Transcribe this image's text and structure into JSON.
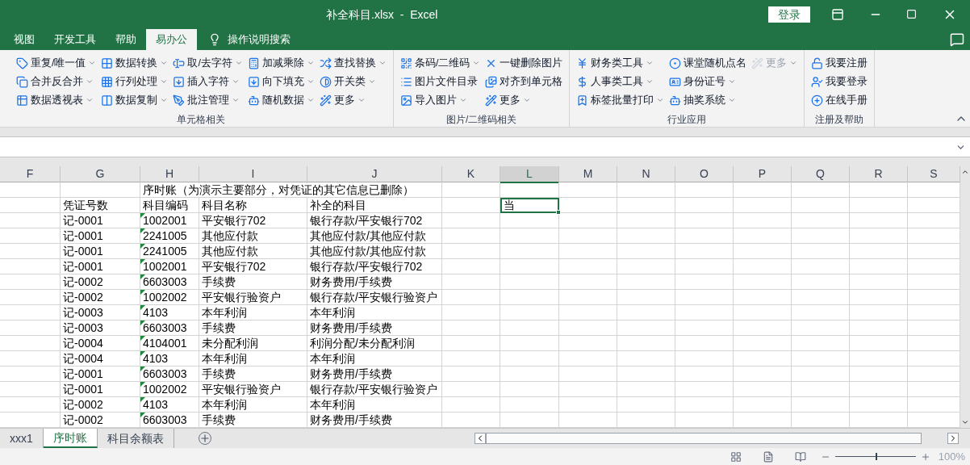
{
  "window": {
    "title": "补全科目.xlsx  -  Excel",
    "login_button": "登录"
  },
  "menu_tabs": [
    {
      "label": "视图",
      "selected": false
    },
    {
      "label": "开发工具",
      "selected": false
    },
    {
      "label": "帮助",
      "selected": false
    },
    {
      "label": "易办公",
      "selected": true
    }
  ],
  "tell_me": {
    "placeholder": "操作说明搜索"
  },
  "ribbon": {
    "groups": [
      {
        "label": "单元格相关",
        "columns": [
          [
            {
              "label": "重复/唯一值",
              "dropdown": true,
              "disabled": false
            },
            {
              "label": "合并反合并",
              "dropdown": true,
              "disabled": false
            },
            {
              "label": "数据透视表",
              "dropdown": true,
              "disabled": false
            }
          ],
          [
            {
              "label": "数据转换",
              "dropdown": true,
              "disabled": false
            },
            {
              "label": "行列处理",
              "dropdown": true,
              "disabled": false
            },
            {
              "label": "数据复制",
              "dropdown": true,
              "disabled": false
            }
          ],
          [
            {
              "label": "取/去字符",
              "dropdown": true,
              "disabled": false
            },
            {
              "label": "插入字符",
              "dropdown": true,
              "disabled": false
            },
            {
              "label": "批注管理",
              "dropdown": true,
              "disabled": false
            }
          ],
          [
            {
              "label": "加减乘除",
              "dropdown": true,
              "disabled": false
            },
            {
              "label": "向下填充",
              "dropdown": true,
              "disabled": false
            },
            {
              "label": "随机数据",
              "dropdown": true,
              "disabled": false
            }
          ],
          [
            {
              "label": "查找替换",
              "dropdown": true,
              "disabled": false
            },
            {
              "label": "开关类",
              "dropdown": true,
              "disabled": false
            },
            {
              "label": "更多",
              "dropdown": true,
              "disabled": false
            }
          ]
        ]
      },
      {
        "label": "图片/二维码相关",
        "columns": [
          [
            {
              "label": "条码/二维码",
              "dropdown": true,
              "disabled": false
            },
            {
              "label": "图片文件目录",
              "dropdown": false,
              "disabled": false
            },
            {
              "label": "导入图片",
              "dropdown": true,
              "disabled": false
            }
          ],
          [
            {
              "label": "一键删除图片",
              "dropdown": false,
              "disabled": false
            },
            {
              "label": "对齐到单元格",
              "dropdown": false,
              "disabled": false
            },
            {
              "label": "更多",
              "dropdown": true,
              "disabled": false
            }
          ]
        ]
      },
      {
        "label": "行业应用",
        "columns": [
          [
            {
              "label": "财务类工具",
              "dropdown": true,
              "disabled": false
            },
            {
              "label": "人事类工具",
              "dropdown": true,
              "disabled": false
            },
            {
              "label": "标签批量打印",
              "dropdown": true,
              "disabled": false
            }
          ],
          [
            {
              "label": "课堂随机点名",
              "dropdown": false,
              "disabled": false
            },
            {
              "label": "身份证号",
              "dropdown": true,
              "disabled": false
            },
            {
              "label": "抽奖系统",
              "dropdown": true,
              "disabled": false
            }
          ],
          [
            {
              "label": "更多",
              "dropdown": true,
              "disabled": true
            }
          ]
        ]
      },
      {
        "label": "注册及帮助",
        "columns": [
          [
            {
              "label": "我要注册",
              "dropdown": false,
              "disabled": false
            },
            {
              "label": "我要登录",
              "dropdown": false,
              "disabled": false
            },
            {
              "label": "在线手册",
              "dropdown": false,
              "disabled": false
            }
          ]
        ]
      }
    ]
  },
  "sheet": {
    "columns": [
      {
        "label": "F",
        "selected": false
      },
      {
        "label": "G",
        "selected": false
      },
      {
        "label": "H",
        "selected": false
      },
      {
        "label": "I",
        "selected": false
      },
      {
        "label": "J",
        "selected": false
      },
      {
        "label": "K",
        "selected": false
      },
      {
        "label": "L",
        "selected": true
      },
      {
        "label": "M",
        "selected": false
      },
      {
        "label": "N",
        "selected": false
      },
      {
        "label": "O",
        "selected": false
      },
      {
        "label": "P",
        "selected": false
      },
      {
        "label": "Q",
        "selected": false
      },
      {
        "label": "R",
        "selected": false
      },
      {
        "label": "S",
        "selected": false
      }
    ],
    "title": "序时账（为演示主要部分，对凭证的其它信息已删除）",
    "headers": [
      "凭证号数",
      "科目编码",
      "科目名称",
      "补全的科目"
    ],
    "active_cell": {
      "value": "当"
    },
    "rows": [
      {
        "voucher": "记-0001",
        "code": "1002001",
        "name": "平安银行702",
        "full": "银行存款/平安银行702",
        "error_mark": true
      },
      {
        "voucher": "记-0001",
        "code": "2241005",
        "name": "其他应付款",
        "full": "其他应付款/其他应付款",
        "error_mark": true
      },
      {
        "voucher": "记-0001",
        "code": "2241005",
        "name": "其他应付款",
        "full": "其他应付款/其他应付款",
        "error_mark": true
      },
      {
        "voucher": "记-0001",
        "code": "1002001",
        "name": "平安银行702",
        "full": "银行存款/平安银行702",
        "error_mark": true
      },
      {
        "voucher": "记-0002",
        "code": "6603003",
        "name": "手续费",
        "full": "财务费用/手续费",
        "error_mark": true
      },
      {
        "voucher": "记-0002",
        "code": "1002002",
        "name": "平安银行验资户",
        "full": "银行存款/平安银行验资户",
        "error_mark": true
      },
      {
        "voucher": "记-0003",
        "code": "4103",
        "name": "本年利润",
        "full": "本年利润",
        "error_mark": true
      },
      {
        "voucher": "记-0003",
        "code": "6603003",
        "name": "手续费",
        "full": "财务费用/手续费",
        "error_mark": true
      },
      {
        "voucher": "记-0004",
        "code": "4104001",
        "name": "未分配利润",
        "full": "利润分配/未分配利润",
        "error_mark": true
      },
      {
        "voucher": "记-0004",
        "code": "4103",
        "name": "本年利润",
        "full": "本年利润",
        "error_mark": true
      },
      {
        "voucher": "记-0001",
        "code": "6603003",
        "name": "手续费",
        "full": "财务费用/手续费",
        "error_mark": true
      },
      {
        "voucher": "记-0001",
        "code": "1002002",
        "name": "平安银行验资户",
        "full": "银行存款/平安银行验资户",
        "error_mark": true
      },
      {
        "voucher": "记-0002",
        "code": "4103",
        "name": "本年利润",
        "full": "本年利润",
        "error_mark": true
      },
      {
        "voucher": "记-0002",
        "code": "6603003",
        "name": "手续费",
        "full": "财务费用/手续费",
        "error_mark": true
      }
    ]
  },
  "sheet_tabs": [
    {
      "label": "xxx1",
      "selected": false
    },
    {
      "label": "序时账",
      "selected": true
    },
    {
      "label": "科目余额表",
      "selected": false
    }
  ],
  "status_bar": {
    "zoom": "100%",
    "zoom_slider": {
      "level": 0.5
    }
  }
}
